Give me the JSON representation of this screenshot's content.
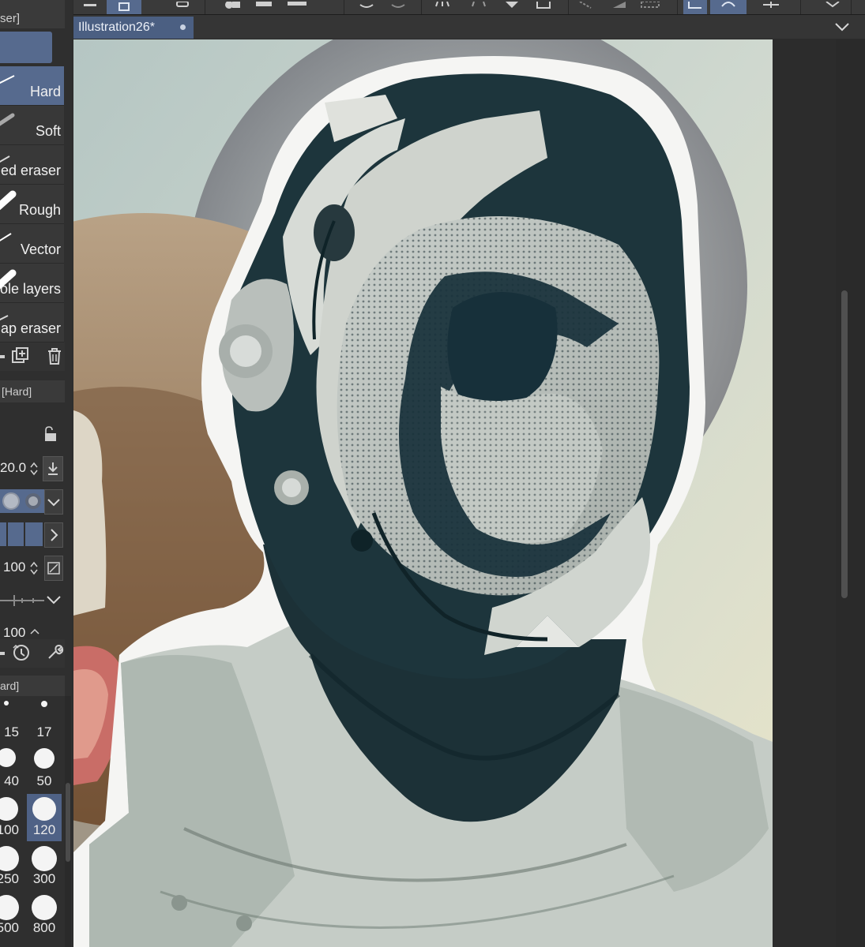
{
  "document": {
    "tab_title": "Illustration26*"
  },
  "left_panel": {
    "top_header": "ser]",
    "subtools": [
      {
        "label": "Hard",
        "selected": true
      },
      {
        "label": "Soft",
        "selected": false
      },
      {
        "label": "ed eraser",
        "selected": false
      },
      {
        "label": "Rough",
        "selected": false
      },
      {
        "label": "Vector",
        "selected": false
      },
      {
        "label": "ole layers",
        "selected": false
      },
      {
        "label": "ap eraser",
        "selected": false
      }
    ],
    "tool_property_header": "[Hard]",
    "size_value": "20.0",
    "opacity_value": "100",
    "hardness_value": "100",
    "brush_size_header": "ard]",
    "brush_sizes": [
      "15",
      "17",
      "40",
      "50",
      "100",
      "120",
      "250",
      "300",
      "500",
      "800"
    ],
    "selected_brush_size": "120"
  },
  "colors": {
    "accent": "#566a8e",
    "panel_bg": "#2f2f2f",
    "toolbar_bg": "#3a3a3a"
  }
}
